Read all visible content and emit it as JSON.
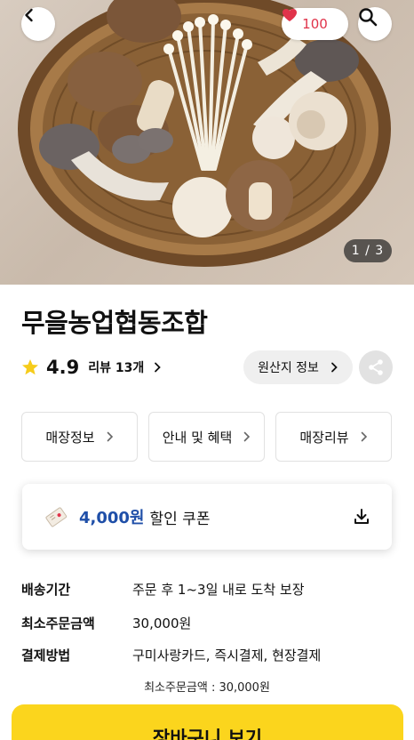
{
  "hero": {
    "like_count": "100",
    "pager": "1 / 3",
    "icons": [
      "chevron-left-icon",
      "heart-icon",
      "search-icon"
    ],
    "colors": {
      "like": "#e0334a",
      "pager_bg": "#3a3a3a"
    }
  },
  "store": {
    "name": "무을농업협동조합",
    "rating": "4.9",
    "review_label": "리뷰 13개",
    "origin_label": "원산지 정보"
  },
  "tabs": [
    {
      "label": "매장정보"
    },
    {
      "label": "안내 및 혜택"
    },
    {
      "label": "매장리뷰"
    }
  ],
  "coupon": {
    "amount": "4,000원",
    "text": "할인 쿠폰",
    "amount_color": "#1f4fa8"
  },
  "info": [
    {
      "label": "배송기간",
      "value": "주문 후 1~3일 내로 도착 보장"
    },
    {
      "label": "최소주문금액",
      "value": "30,000원"
    },
    {
      "label": "결제방법",
      "value": "구미사랑카드, 즉시결제, 현장결제"
    }
  ],
  "min_note": "최소주문금액 : 30,000원",
  "cart": {
    "label": "장바구니 보기",
    "color": "#fbd51d"
  }
}
